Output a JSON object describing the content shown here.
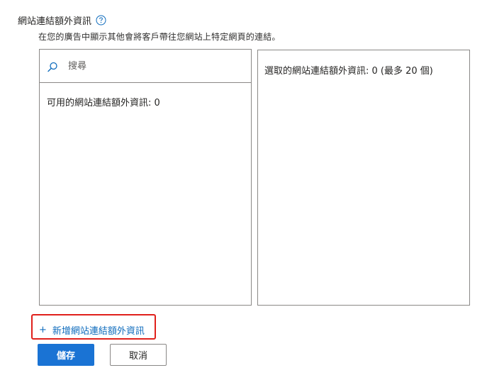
{
  "section": {
    "title": "網站連結額外資訊",
    "description": "在您的廣告中顯示其他會將客戶帶往您網站上特定網頁的連結。"
  },
  "search": {
    "placeholder": "搜尋"
  },
  "available": {
    "label": "可用的網站連結額外資訊:  0"
  },
  "selected": {
    "label": "選取的網站連結額外資訊:  0 (最多 20 個)"
  },
  "actions": {
    "add_plus": "+",
    "add_label": "新增網站連結額外資訊",
    "save_label": "儲存",
    "cancel_label": "取消"
  },
  "colors": {
    "primary": "#1a73d4",
    "link": "#0f6cbd",
    "highlight": "#e0201b",
    "border": "#8a8886"
  },
  "icons": {
    "help": "help-circle-icon",
    "search": "search-icon"
  }
}
